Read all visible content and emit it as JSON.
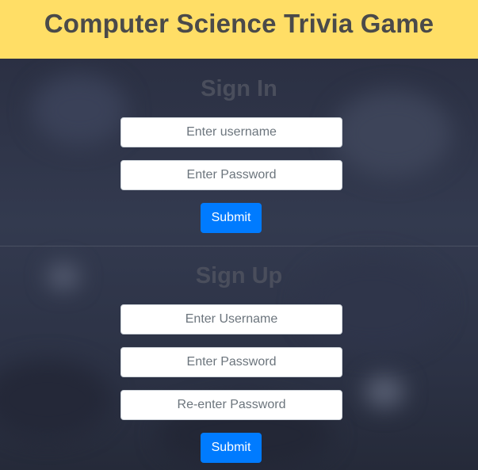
{
  "header": {
    "title": "Computer Science Trivia Game",
    "background_color": "#ffde66"
  },
  "sign_in": {
    "heading": "Sign In",
    "username_placeholder": "Enter username",
    "password_placeholder": "Enter Password",
    "submit_label": "Submit"
  },
  "sign_up": {
    "heading": "Sign Up",
    "username_placeholder": "Enter Username",
    "password_placeholder": "Enter Password",
    "reenter_password_placeholder": "Re-enter Password",
    "submit_label": "Submit"
  },
  "colors": {
    "accent": "#007bff",
    "heading_text": "#4a4e5c"
  }
}
